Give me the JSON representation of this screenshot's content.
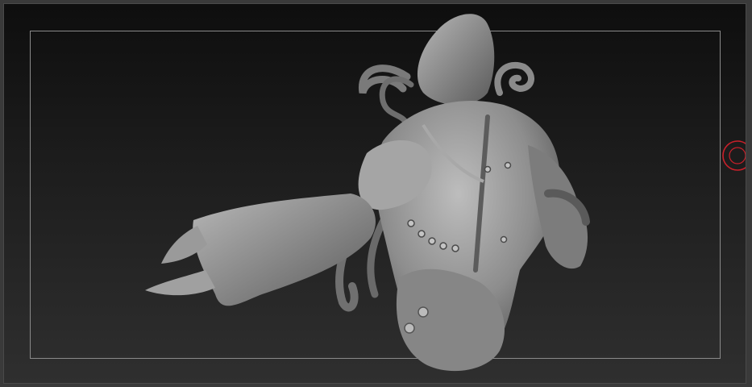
{
  "viewport": {
    "background_top": "#0e0e0e",
    "background_bottom": "#2f2f2f",
    "frame_color": "#8a8a8a",
    "model_color": "#8d8d8d",
    "pivot_color": "#c8202a"
  },
  "icons": {
    "model": "sculpt-model",
    "pivot": "rotation-pivot-icon"
  }
}
